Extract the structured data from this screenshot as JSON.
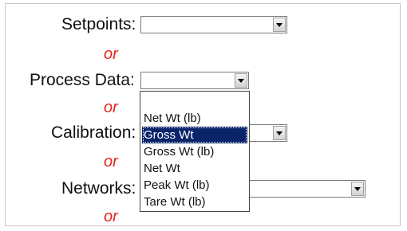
{
  "form": {
    "setpoints_label": "Setpoints:",
    "process_data_label": "Process Data:",
    "calibration_label": "Calibration:",
    "networks_label": "Networks:",
    "or_text": "or"
  },
  "process_data_dropdown": {
    "options": [
      "Net Wt (lb)",
      "Gross Wt",
      "Gross Wt (lb)",
      "Net Wt",
      "Peak Wt (lb)",
      "Tare Wt (lb)"
    ],
    "highlighted_option": "Gross Wt"
  },
  "colors": {
    "or_text": "#e3261b",
    "highlight_bg": "#0a246a",
    "highlight_text": "#ffffff"
  },
  "icons": {
    "select_arrow": "chevron-down-icon"
  }
}
